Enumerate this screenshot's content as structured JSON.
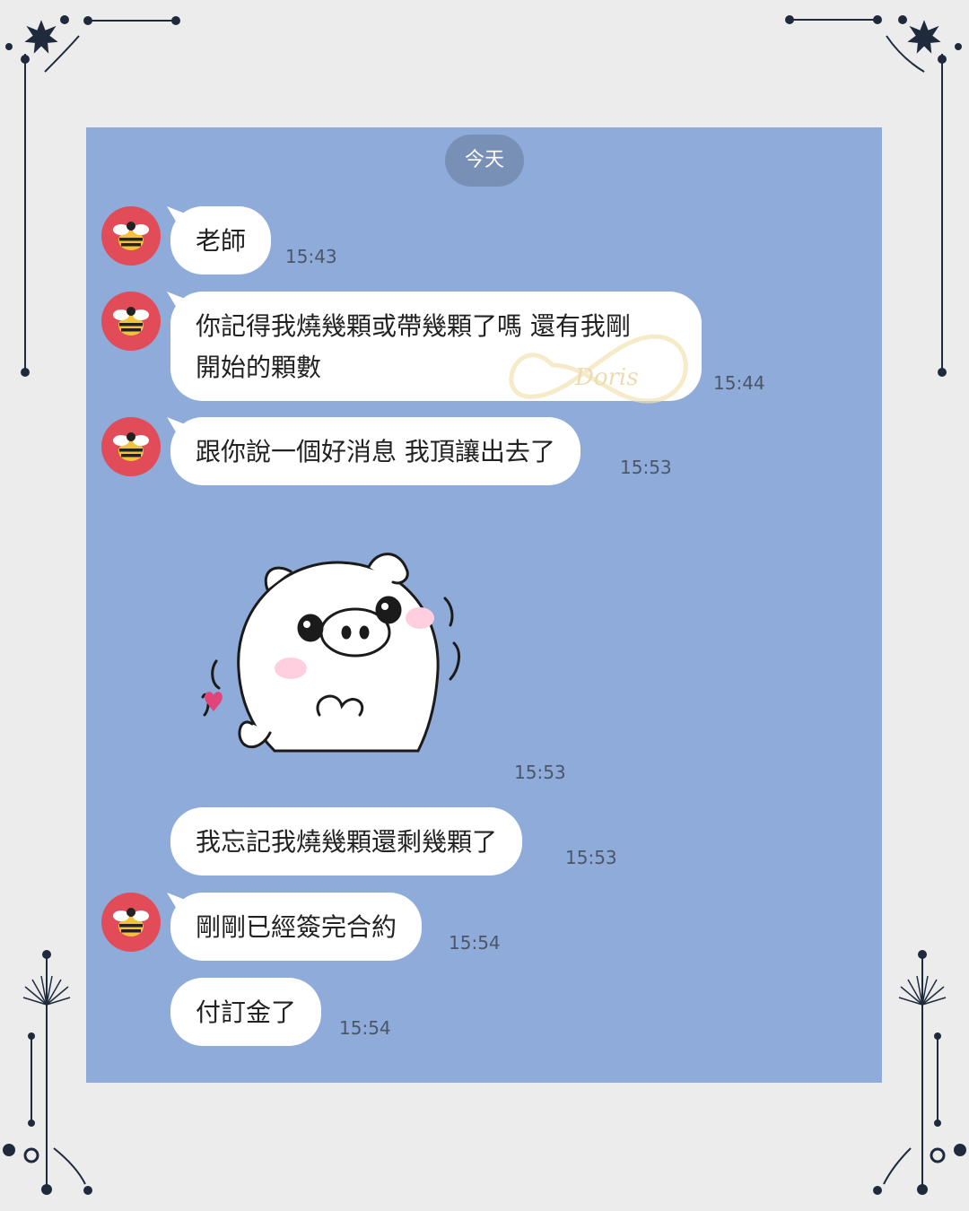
{
  "chat": {
    "date_label": "今天",
    "messages": [
      {
        "text": "老師",
        "time": "15:43",
        "avatar": "bee-avatar-icon"
      },
      {
        "text": "你記得我燒幾顆或帶幾顆了嗎 還有我剛開始的顆數",
        "line1": "你記得我燒幾顆或帶幾顆了嗎 還有我剛",
        "line2": "開始的顆數",
        "time": "15:44",
        "avatar": "bee-avatar-icon"
      },
      {
        "text": "跟你說一個好消息 我頂讓出去了",
        "time": "15:53",
        "avatar": "bee-avatar-icon"
      },
      {
        "sticker": "pig-sticker-icon",
        "time": "15:53"
      },
      {
        "text": "我忘記我燒幾顆還剩幾顆了",
        "time": "15:53"
      },
      {
        "text": "剛剛已經簽完合約",
        "time": "15:54",
        "avatar": "bee-avatar-icon"
      },
      {
        "text": "付訂金了",
        "time": "15:54"
      }
    ]
  },
  "watermark": {
    "brand": "Doris"
  },
  "colors": {
    "chat_background": "#8eabd9",
    "page_background": "#ececec",
    "bubble": "#ffffff",
    "avatar_red": "#e24b58",
    "date_pill": "#7890b6",
    "frame_ornament": "#1f2a3c"
  }
}
